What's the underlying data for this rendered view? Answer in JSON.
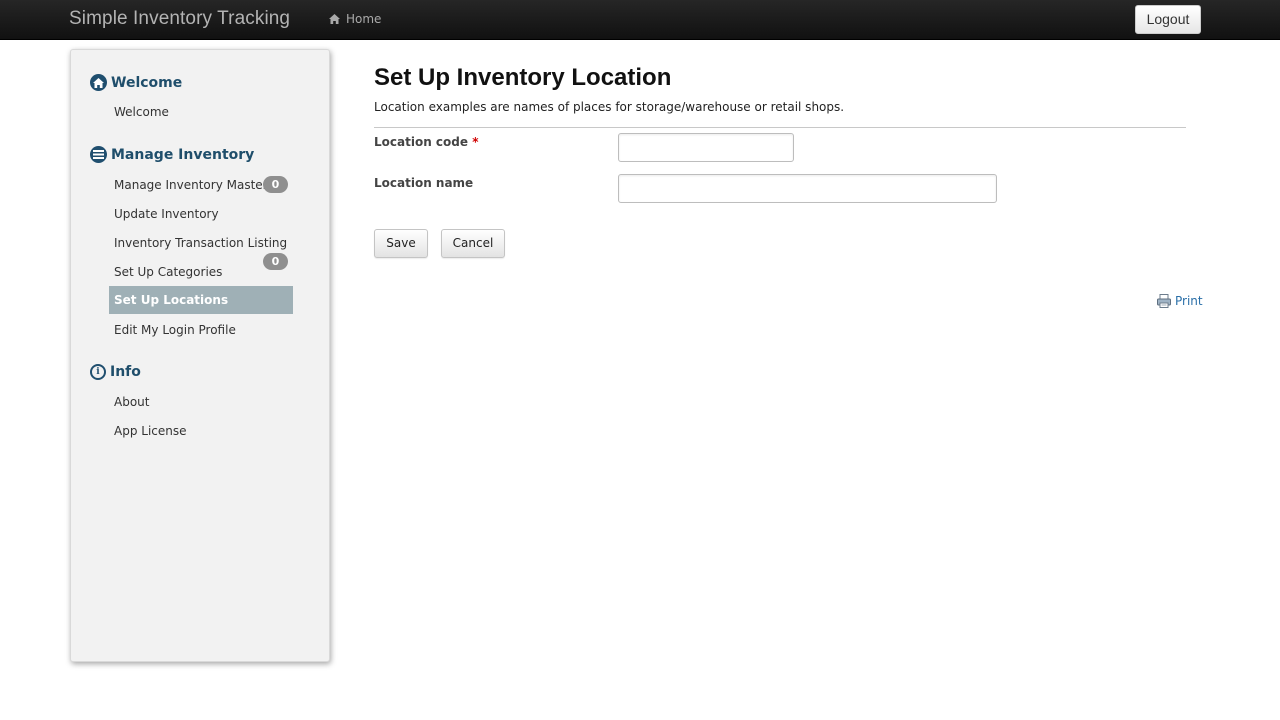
{
  "navbar": {
    "brand": "Simple Inventory Tracking",
    "home_label": "Home",
    "logout_label": "Logout"
  },
  "sidebar": {
    "sections": [
      {
        "title": "Welcome",
        "icon": "home-circle-icon",
        "items": [
          "Welcome"
        ]
      },
      {
        "title": "Manage Inventory",
        "icon": "list-circle-icon",
        "items": [
          "Manage Inventory Master",
          "Update Inventory",
          "Inventory Transaction Listing",
          "Set Up Categories",
          "Set Up Locations",
          "Edit My Login Profile"
        ]
      },
      {
        "title": "Info",
        "icon": "info-circle-icon",
        "items": [
          "About",
          "App License"
        ]
      }
    ],
    "active_item": "Set Up Locations",
    "badges": [
      "0",
      "0"
    ]
  },
  "main": {
    "title": "Set Up Inventory Location",
    "description": "Location examples are names of places for storage/warehouse or retail shops.",
    "fields": [
      {
        "label": "Location code",
        "required_mark": "*",
        "value": ""
      },
      {
        "label": "Location name",
        "value": ""
      }
    ],
    "save_label": "Save",
    "cancel_label": "Cancel",
    "print_label": "Print"
  },
  "colors": {
    "navbar_bg": "#1a1a1a",
    "section_heading": "#1f4e6b",
    "active_item_bg": "#9fb0b6",
    "link": "#2a6fa8",
    "required": "#d00000"
  }
}
